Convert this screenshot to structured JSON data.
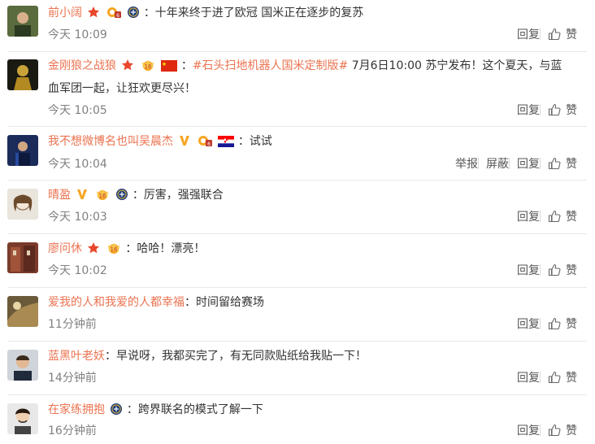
{
  "comments": [
    {
      "user": "前小阔",
      "text": "：十年来终于进了欧冠 国米正在逐步的复苏",
      "time": "今天 10:09",
      "actions": [
        "回复",
        "赞"
      ]
    },
    {
      "user": "金刚狼之战狼",
      "topic": "#石头扫地机器人国米定制版#",
      "text": " 7月6日10:00 苏宁发布！这个夏天，与蓝",
      "text2": "血军团一起，让狂欢更尽兴！",
      "time": "今天 10:05",
      "actions": [
        "回复",
        "赞"
      ]
    },
    {
      "user": "我不想微博名也叫吴晨杰",
      "text": "：试试",
      "time": "今天 10:04",
      "actions": [
        "举报",
        "屏蔽",
        "回复",
        "赞"
      ]
    },
    {
      "user": "晴盈",
      "text": "：厉害，强强联合",
      "time": "今天 10:03",
      "actions": [
        "回复",
        "赞"
      ]
    },
    {
      "user": "廖问休",
      "text": "：哈哈！漂亮！",
      "time": "今天 10:02",
      "actions": [
        "回复",
        "赞"
      ]
    },
    {
      "user": "爱我的人和我爱的人都幸福",
      "text": "：时间留给赛场",
      "time": "11分钟前",
      "actions": [
        "回复",
        "赞"
      ]
    },
    {
      "user": "蓝黑叶老妖",
      "text": "：早说呀，我都买完了，有无同款贴纸给我贴一下！",
      "time": "14分钟前",
      "actions": [
        "回复",
        "赞"
      ]
    },
    {
      "user": "在家练拥抱",
      "text": "：跨界联名的模式了解一下",
      "time": "16分钟前",
      "actions": [
        "回复",
        "赞"
      ]
    }
  ],
  "colors": {
    "username": "#eb7350",
    "text": "#333333",
    "time": "#808080",
    "divider": "#e8e8e8"
  }
}
